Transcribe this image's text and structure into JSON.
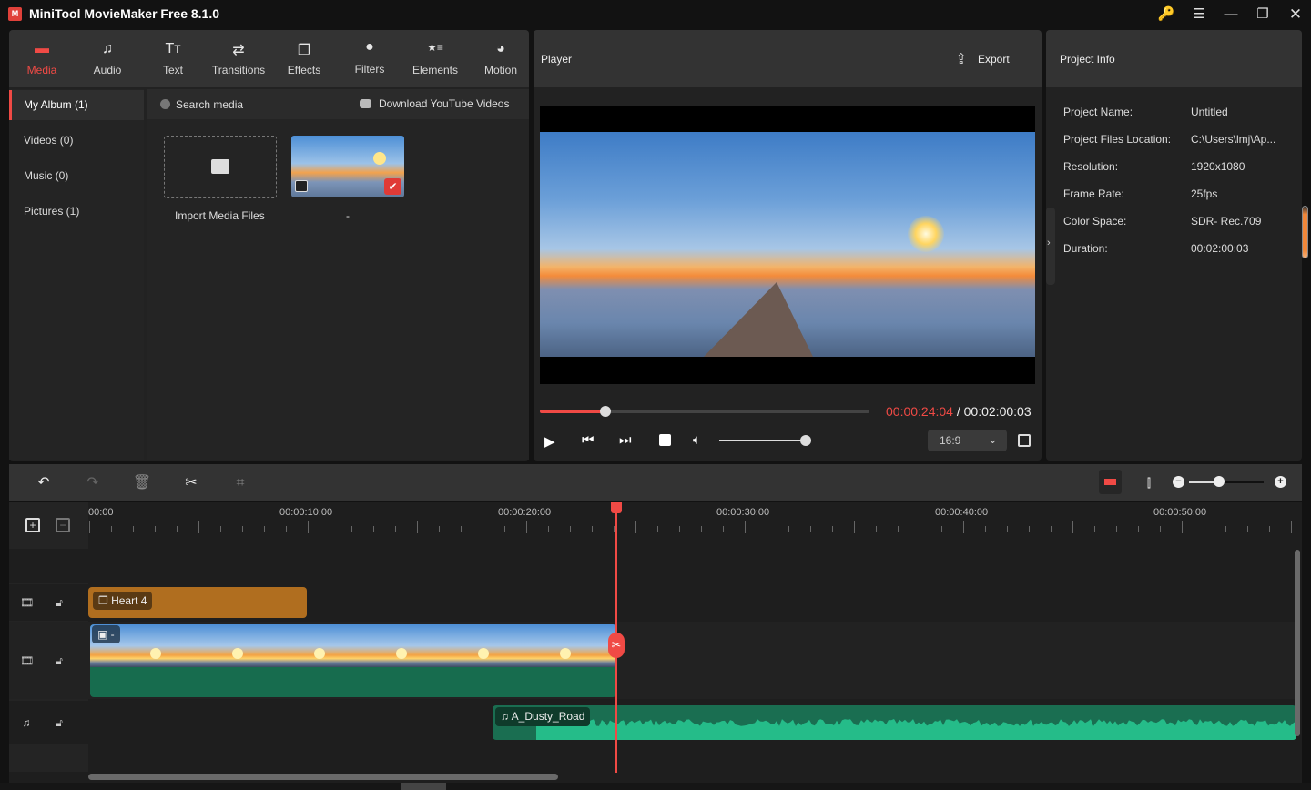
{
  "window": {
    "title": "MiniTool MovieMaker Free 8.1.0",
    "logo_glyph": "M",
    "controls": [
      {
        "name": "key-icon",
        "glyph": "🔑"
      },
      {
        "name": "menu-icon",
        "glyph": "☰"
      },
      {
        "name": "minimize-icon",
        "glyph": "—"
      },
      {
        "name": "restore-icon",
        "glyph": "❐"
      },
      {
        "name": "close-icon",
        "glyph": "✕"
      }
    ]
  },
  "media_tabs": [
    {
      "label": "Media",
      "icon": "folder-icon",
      "glyph": "▬",
      "active": true
    },
    {
      "label": "Audio",
      "icon": "music-note-icon",
      "glyph": "♫",
      "active": false
    },
    {
      "label": "Text",
      "icon": "text-icon",
      "glyph": "Tт",
      "active": false
    },
    {
      "label": "Transitions",
      "icon": "transition-arrows-icon",
      "glyph": "⇄",
      "active": false
    },
    {
      "label": "Effects",
      "icon": "effects-icon",
      "glyph": "❐",
      "active": false
    },
    {
      "label": "Filters",
      "icon": "filters-icon",
      "glyph": "●",
      "active": false
    },
    {
      "label": "Elements",
      "icon": "elements-icon",
      "glyph": "★≡",
      "active": false
    },
    {
      "label": "Motion",
      "icon": "motion-icon",
      "glyph": "◕",
      "active": false
    }
  ],
  "album": {
    "items": [
      {
        "label": "My Album (1)",
        "active": true
      },
      {
        "label": "Videos (0)",
        "active": false
      },
      {
        "label": "Music (0)",
        "active": false
      },
      {
        "label": "Pictures (1)",
        "active": false
      }
    ]
  },
  "media_bar": {
    "search_placeholder": "Search media",
    "download_label": "Download YouTube Videos"
  },
  "media_items": {
    "import_label": "Import Media Files",
    "clip_name": "-"
  },
  "player": {
    "title": "Player",
    "export_label": "Export",
    "current_time": "00:00:24:04",
    "separator": " / ",
    "total_time": "00:02:00:03",
    "progress_fraction": 0.2,
    "volume_fraction": 1.0,
    "aspect_ratio": "16:9"
  },
  "project_info": {
    "title": "Project Info",
    "rows": [
      {
        "label": "Project Name:",
        "value": "Untitled"
      },
      {
        "label": "Project Files Location:",
        "value": "C:\\Users\\lmj\\Ap..."
      },
      {
        "label": "Resolution:",
        "value": "1920x1080"
      },
      {
        "label": "Frame Rate:",
        "value": "25fps"
      },
      {
        "label": "Color Space:",
        "value": "SDR- Rec.709"
      },
      {
        "label": "Duration:",
        "value": "00:02:00:03"
      }
    ]
  },
  "timeline": {
    "zoom_fraction": 0.4,
    "ruler_labels": [
      "00:00",
      "00:00:10:00",
      "00:00:20:00",
      "00:00:30:00",
      "00:00:40:00",
      "00:00:50:00"
    ],
    "playhead_time": "00:00:24:04",
    "tracks": {
      "effect_clip": "Heart 4",
      "video_clip": "-",
      "audio_clip": "A_Dusty_Road"
    },
    "colors": {
      "accent": "#f04a45",
      "effect_clip": "#b06e1f",
      "video_base": "#176c4e",
      "audio_wave": "#25bc89"
    }
  }
}
